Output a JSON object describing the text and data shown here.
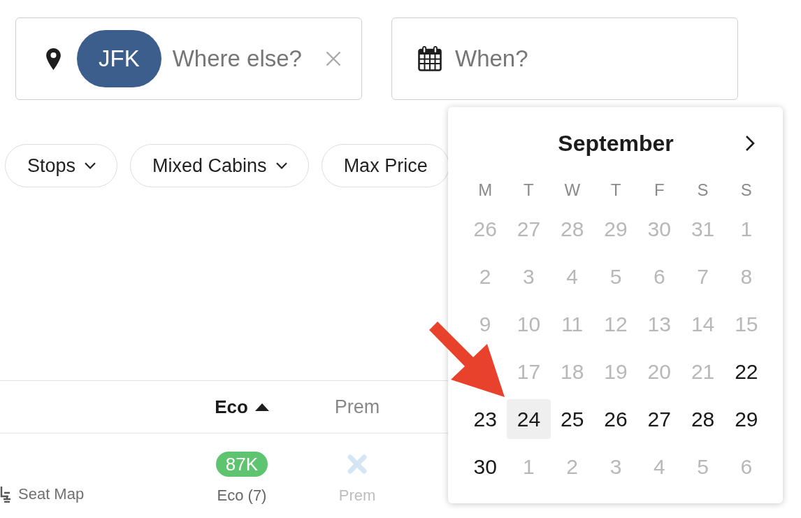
{
  "origin_field": {
    "tags": [
      "JFK"
    ],
    "placeholder": "Where else?"
  },
  "date_field": {
    "placeholder": "When?"
  },
  "filters": [
    {
      "label": "Stops",
      "caret": true
    },
    {
      "label": "Mixed Cabins",
      "caret": true
    },
    {
      "label": "Max Price",
      "caret": false
    }
  ],
  "calendar": {
    "month": "September",
    "weekdays": [
      "M",
      "T",
      "W",
      "T",
      "F",
      "S",
      "S"
    ],
    "weeks": [
      [
        {
          "kind": "day",
          "label": "26",
          "disabled": true,
          "selected": false
        },
        {
          "kind": "day",
          "label": "27",
          "disabled": true,
          "selected": false
        },
        {
          "kind": "day",
          "label": "28",
          "disabled": true,
          "selected": false
        },
        {
          "kind": "day",
          "label": "29",
          "disabled": true,
          "selected": false
        },
        {
          "kind": "day",
          "label": "30",
          "disabled": true,
          "selected": false
        },
        {
          "kind": "day",
          "label": "31",
          "disabled": true,
          "selected": false
        },
        {
          "kind": "day",
          "label": "1",
          "disabled": true,
          "selected": false
        }
      ],
      [
        {
          "kind": "day",
          "label": "2",
          "disabled": true,
          "selected": false
        },
        {
          "kind": "day",
          "label": "3",
          "disabled": true,
          "selected": false
        },
        {
          "kind": "day",
          "label": "4",
          "disabled": true,
          "selected": false
        },
        {
          "kind": "day",
          "label": "5",
          "disabled": true,
          "selected": false
        },
        {
          "kind": "day",
          "label": "6",
          "disabled": true,
          "selected": false
        },
        {
          "kind": "day",
          "label": "7",
          "disabled": true,
          "selected": false
        },
        {
          "kind": "day",
          "label": "8",
          "disabled": true,
          "selected": false
        }
      ],
      [
        {
          "kind": "day",
          "label": "9",
          "disabled": true,
          "selected": false
        },
        {
          "kind": "day",
          "label": "10",
          "disabled": true,
          "selected": false
        },
        {
          "kind": "day",
          "label": "11",
          "disabled": true,
          "selected": false
        },
        {
          "kind": "day",
          "label": "12",
          "disabled": true,
          "selected": false
        },
        {
          "kind": "day",
          "label": "13",
          "disabled": true,
          "selected": false
        },
        {
          "kind": "day",
          "label": "14",
          "disabled": true,
          "selected": false
        },
        {
          "kind": "day",
          "label": "15",
          "disabled": true,
          "selected": false
        }
      ],
      [
        {
          "kind": "covered"
        },
        {
          "kind": "day",
          "label": "17",
          "disabled": true,
          "selected": false
        },
        {
          "kind": "day",
          "label": "18",
          "disabled": true,
          "selected": false
        },
        {
          "kind": "day",
          "label": "19",
          "disabled": true,
          "selected": false
        },
        {
          "kind": "day",
          "label": "20",
          "disabled": true,
          "selected": false
        },
        {
          "kind": "day",
          "label": "21",
          "disabled": true,
          "selected": false
        },
        {
          "kind": "day",
          "label": "22",
          "disabled": false,
          "selected": false
        }
      ],
      [
        {
          "kind": "day",
          "label": "23",
          "disabled": false,
          "selected": false
        },
        {
          "kind": "day",
          "label": "24",
          "disabled": false,
          "selected": true
        },
        {
          "kind": "day",
          "label": "25",
          "disabled": false,
          "selected": false
        },
        {
          "kind": "day",
          "label": "26",
          "disabled": false,
          "selected": false
        },
        {
          "kind": "day",
          "label": "27",
          "disabled": false,
          "selected": false
        },
        {
          "kind": "day",
          "label": "28",
          "disabled": false,
          "selected": false
        },
        {
          "kind": "day",
          "label": "29",
          "disabled": false,
          "selected": false
        }
      ],
      [
        {
          "kind": "day",
          "label": "30",
          "disabled": false,
          "selected": false
        },
        {
          "kind": "day",
          "label": "1",
          "disabled": true,
          "selected": false
        },
        {
          "kind": "day",
          "label": "2",
          "disabled": true,
          "selected": false
        },
        {
          "kind": "day",
          "label": "3",
          "disabled": true,
          "selected": false
        },
        {
          "kind": "day",
          "label": "4",
          "disabled": true,
          "selected": false
        },
        {
          "kind": "day",
          "label": "5",
          "disabled": true,
          "selected": false
        },
        {
          "kind": "day",
          "label": "6",
          "disabled": true,
          "selected": false
        }
      ]
    ]
  },
  "table": {
    "columns": [
      {
        "label": "Eco",
        "sorted": true
      },
      {
        "label": "Prem",
        "sorted": false
      }
    ],
    "rows": [
      {
        "seat_map": "Seat Map",
        "cells": [
          {
            "kind": "price",
            "price": "87K",
            "cabin": "Eco (7)"
          },
          {
            "kind": "unavailable",
            "cabin": "Prem"
          }
        ]
      }
    ]
  }
}
